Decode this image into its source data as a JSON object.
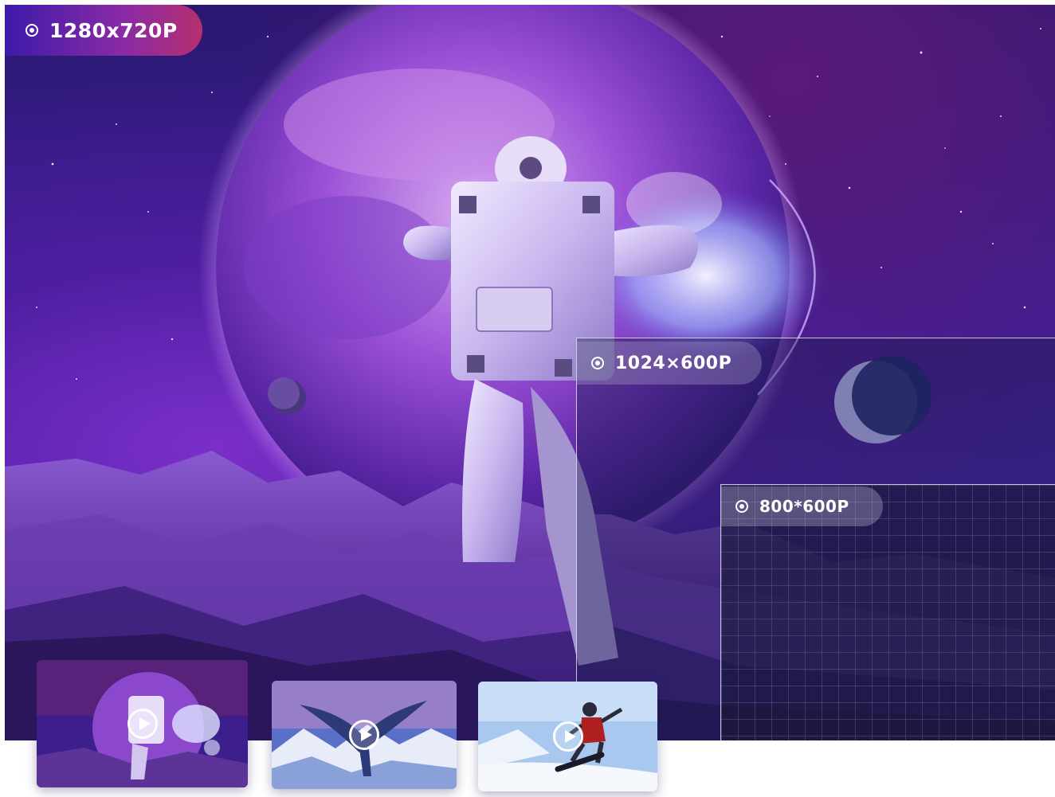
{
  "resolutions": {
    "large": "1280x720P",
    "medium": "1024×600P",
    "small": "800*600P"
  },
  "thumbnails": [
    {
      "icon": "play-icon",
      "subject": "astronaut"
    },
    {
      "icon": "play-icon",
      "subject": "whale"
    },
    {
      "icon": "play-icon",
      "subject": "snowboarder"
    }
  ],
  "colors": {
    "tag_gradient_start": "#3c1ba8",
    "tag_gradient_end": "#b5306e",
    "scene_purple": "#4a25a8"
  }
}
